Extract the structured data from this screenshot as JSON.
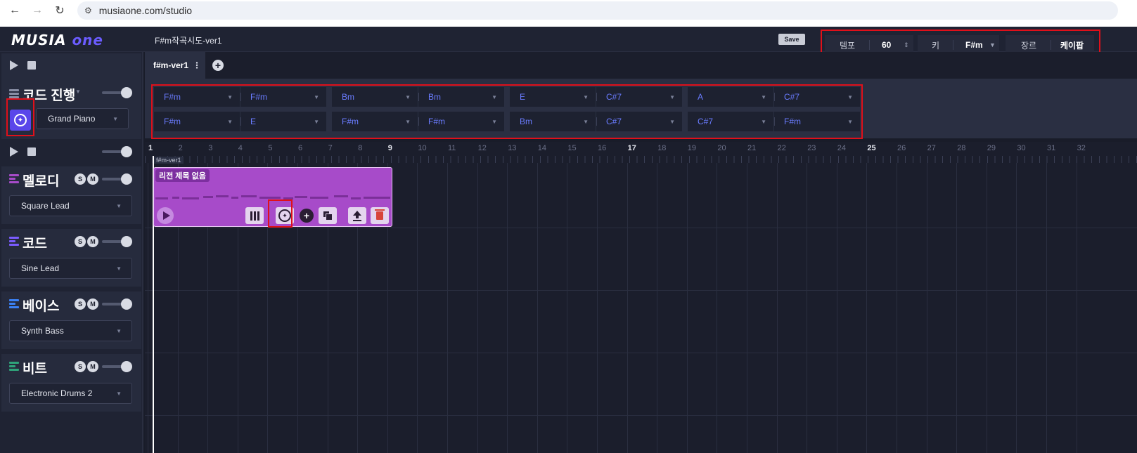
{
  "browser": {
    "url": "musiaone.com/studio",
    "back_icon": "←",
    "forward_icon": "→",
    "reload_icon": "↻",
    "site_icon": "⚙"
  },
  "header": {
    "logo_main": "MUSIA",
    "logo_accent": "one",
    "project_title": "F#m작곡시도-ver1",
    "save_label": "Save",
    "tempo_label": "템포",
    "tempo_value": "60",
    "tempo_arrows": "⇕",
    "key_label": "키",
    "key_value": "F#m",
    "genre_label": "장르",
    "genre_value": "케이팝",
    "dropdown_arrow": "▼"
  },
  "chord_track": {
    "name": "코드 진행",
    "instrument": "Grand Piano"
  },
  "tracks": [
    {
      "name": "멜로디",
      "instrument": "Square Lead",
      "solo": "S",
      "mute": "M",
      "color": "#a74bc9"
    },
    {
      "name": "코드",
      "instrument": "Sine Lead",
      "solo": "S",
      "mute": "M",
      "color": "#7b5cff"
    },
    {
      "name": "베이스",
      "instrument": "Synth Bass",
      "solo": "S",
      "mute": "M",
      "color": "#3b82f6"
    },
    {
      "name": "비트",
      "instrument": "Electronic Drums 2",
      "solo": "S",
      "mute": "M",
      "color": "#2fa37a"
    }
  ],
  "tabs": {
    "active": "f#m-ver1",
    "menu": "⋮",
    "add": "+"
  },
  "chords": {
    "row1": [
      "F#m",
      "F#m",
      "Bm",
      "Bm",
      "E",
      "C#7",
      "A",
      "C#7"
    ],
    "row2": [
      "F#m",
      "E",
      "F#m",
      "F#m",
      "Bm",
      "C#7",
      "C#7",
      "F#m"
    ]
  },
  "timeline": {
    "bars": [
      "1",
      "2",
      "3",
      "4",
      "5",
      "6",
      "7",
      "8",
      "9",
      "10",
      "11",
      "12",
      "13",
      "14",
      "15",
      "16",
      "17",
      "18",
      "19",
      "20",
      "21",
      "22",
      "23",
      "24",
      "25",
      "26",
      "27",
      "28",
      "29",
      "30",
      "31",
      "32"
    ],
    "region_tag": "f#m-ver1",
    "region_name": "리전 제목 없음"
  }
}
